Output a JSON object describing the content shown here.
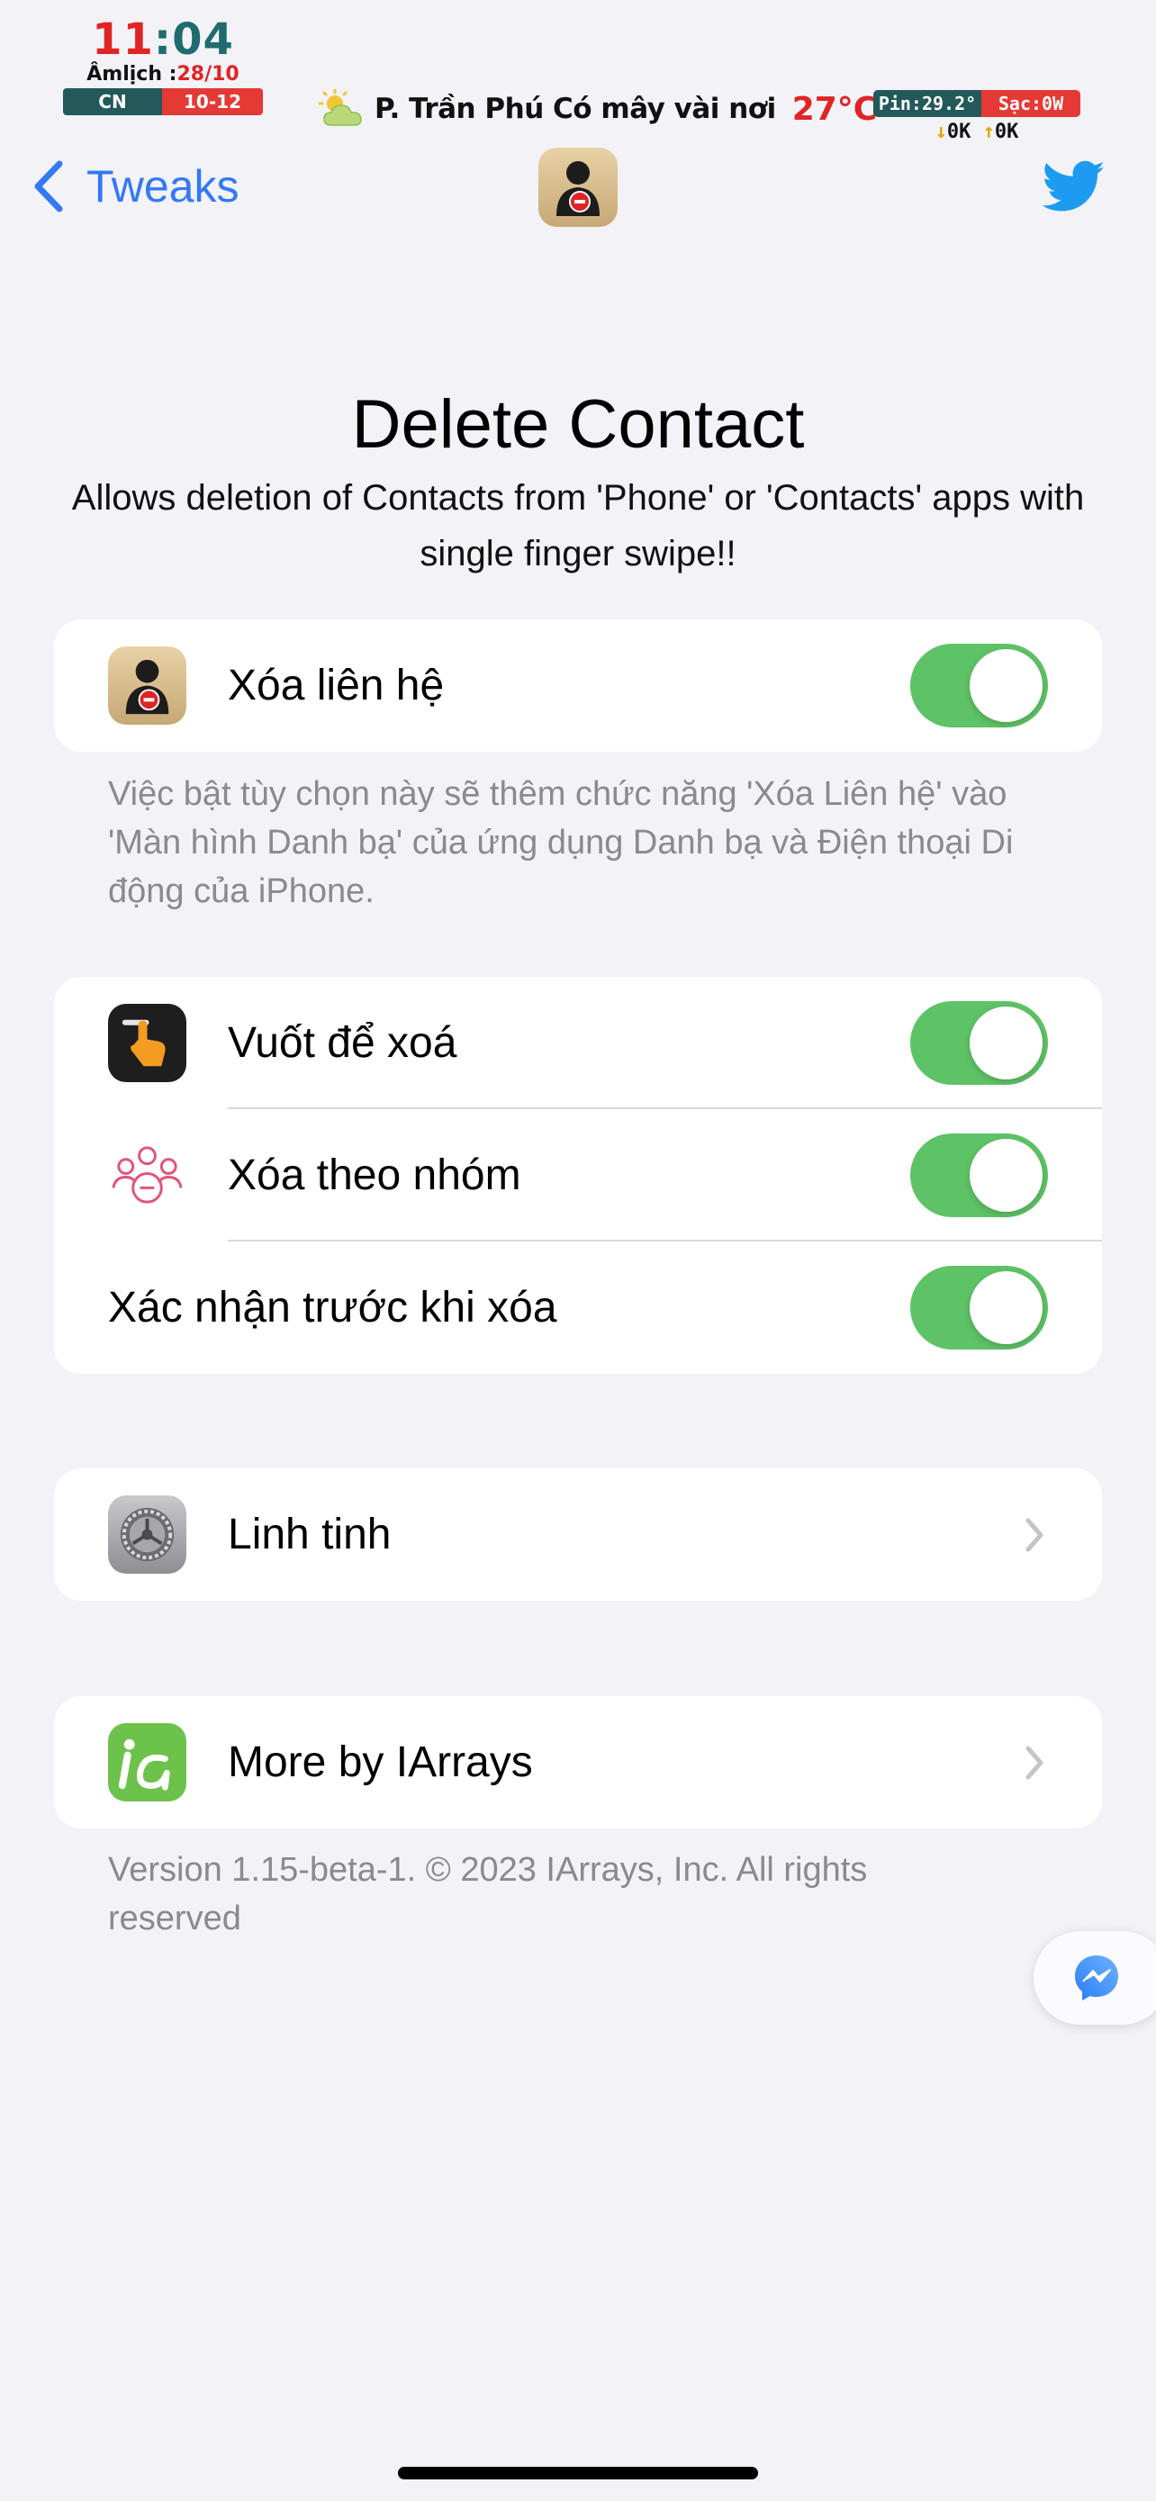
{
  "status_bar": {
    "clock_hour": "11",
    "clock_colon": ":",
    "clock_minute": "04",
    "lunar_label": "Âmlịch :",
    "lunar_date": "28/10",
    "weekday": "CN",
    "solar_date": "10-12",
    "weather_text": "P. Trần Phú Có mây vài nơi",
    "temperature": "27°C",
    "battery_temp": "Pin:29.2°",
    "charging": "Sạc:0W",
    "net_down": "0K",
    "net_up": "0K"
  },
  "nav": {
    "back_label": "Tweaks",
    "app_icon": "delete-contact-app-icon",
    "right_icon": "twitter-icon"
  },
  "header": {
    "title": "Delete Contact",
    "subtitle": "Allows deletion of Contacts from 'Phone' or 'Contacts' apps with single finger swipe!!"
  },
  "group1": {
    "enable_label": "Xóa liên hệ",
    "enable_on": true,
    "footnote": "Việc bật tùy chọn này sẽ thêm chức năng 'Xóa Liên hệ' vào 'Màn hình Danh bạ' của ứng dụng Danh bạ và Điện thoại Di động của iPhone."
  },
  "group2": {
    "items": [
      {
        "label": "Vuốt để xoá",
        "icon": "swipe-finger-icon",
        "on": true
      },
      {
        "label": "Xóa theo nhóm",
        "icon": "group-people-icon",
        "on": true
      },
      {
        "label": "Xác nhận trước khi xóa",
        "icon": "",
        "on": true
      }
    ]
  },
  "group3": {
    "label": "Linh tinh",
    "icon": "settings-gear-icon"
  },
  "group4": {
    "label": "More by IArrays",
    "icon": "iarrays-logo-icon",
    "footnote": "Version 1.15-beta-1. © 2023 IArrays, Inc. All rights reserved"
  },
  "floating_button": {
    "icon": "messenger-icon"
  },
  "colors": {
    "accent": "#3478f6",
    "toggle_on": "#5ec366",
    "background": "#f2f2f7",
    "footnote_text": "#8a8a8e"
  }
}
